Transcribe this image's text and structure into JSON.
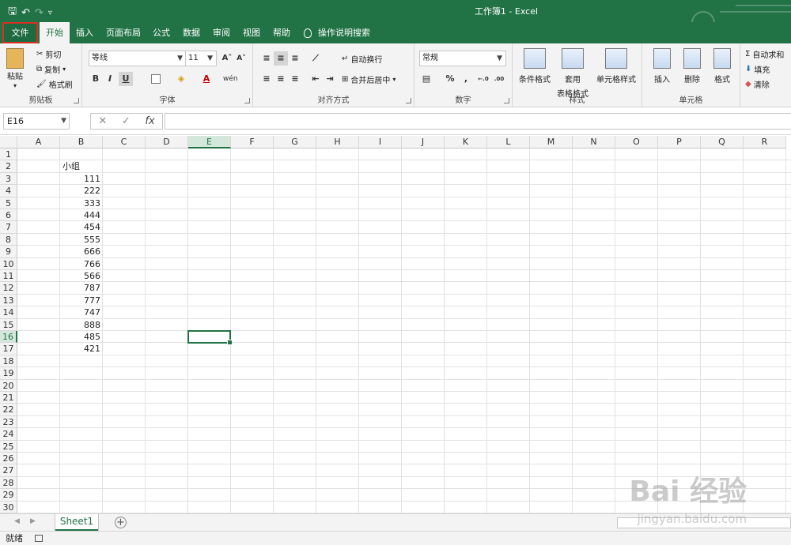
{
  "window": {
    "title": "工作簿1  -  Excel"
  },
  "qat": {
    "save": "🖫",
    "undo": "↶",
    "redo": "↷",
    "customize": "▿"
  },
  "tabs": [
    {
      "label": "文件",
      "key": "file"
    },
    {
      "label": "开始",
      "key": "home"
    },
    {
      "label": "插入",
      "key": "insert"
    },
    {
      "label": "页面布局",
      "key": "layout"
    },
    {
      "label": "公式",
      "key": "formulas"
    },
    {
      "label": "数据",
      "key": "data"
    },
    {
      "label": "审阅",
      "key": "review"
    },
    {
      "label": "视图",
      "key": "view"
    },
    {
      "label": "帮助",
      "key": "help"
    }
  ],
  "tell_me": "操作说明搜索",
  "ribbon": {
    "clipboard": {
      "label": "剪贴板",
      "paste": "粘贴",
      "cut": "剪切",
      "copy": "复制",
      "format_painter": "格式刷"
    },
    "font": {
      "label": "字体",
      "name": "等线",
      "size": "11",
      "bold": "B",
      "italic": "I",
      "underline": "U",
      "grow": "A˄",
      "shrink": "A˅",
      "font_color": "A",
      "phonetic": "wén"
    },
    "alignment": {
      "label": "对齐方式",
      "wrap": "自动换行",
      "merge": "合并后居中"
    },
    "number": {
      "label": "数字",
      "format": "常规",
      "percent": "%",
      "comma": ",",
      "inc_dec": "←.0",
      "dec_dec": ".00"
    },
    "styles": {
      "label": "样式",
      "conditional": "条件格式",
      "table_line1": "套用",
      "table_line2": "表格格式",
      "cell_styles": "单元格样式"
    },
    "cells": {
      "label": "单元格",
      "insert": "插入",
      "delete": "删除",
      "format": "格式"
    },
    "editing": {
      "autosum": "自动求和",
      "fill": "填充",
      "clear": "清除"
    }
  },
  "formula_bar": {
    "name_box": "E16",
    "cancel": "✕",
    "enter": "✓",
    "fx": "fx",
    "formula": ""
  },
  "grid": {
    "columns": [
      "A",
      "B",
      "C",
      "D",
      "E",
      "F",
      "G",
      "H",
      "I",
      "J",
      "K",
      "L",
      "M",
      "N",
      "O",
      "P",
      "Q",
      "R"
    ],
    "rows": [
      "1",
      "2",
      "3",
      "4",
      "5",
      "6",
      "7",
      "8",
      "9",
      "10",
      "11",
      "12",
      "13",
      "14",
      "15",
      "16",
      "17",
      "18",
      "19",
      "20",
      "21",
      "22",
      "23",
      "24",
      "25",
      "26",
      "27",
      "28",
      "29",
      "30"
    ],
    "header_cell": "小组",
    "values": [
      "111",
      "222",
      "333",
      "444",
      "454",
      "555",
      "666",
      "766",
      "566",
      "787",
      "777",
      "747",
      "888",
      "485",
      "421"
    ],
    "selected_cell": "E16"
  },
  "sheets": {
    "active": "Sheet1",
    "add": "+"
  },
  "status": {
    "ready": "就绪"
  },
  "watermark": {
    "main": "Bai 经验",
    "url": "jingyan.baidu.com"
  }
}
